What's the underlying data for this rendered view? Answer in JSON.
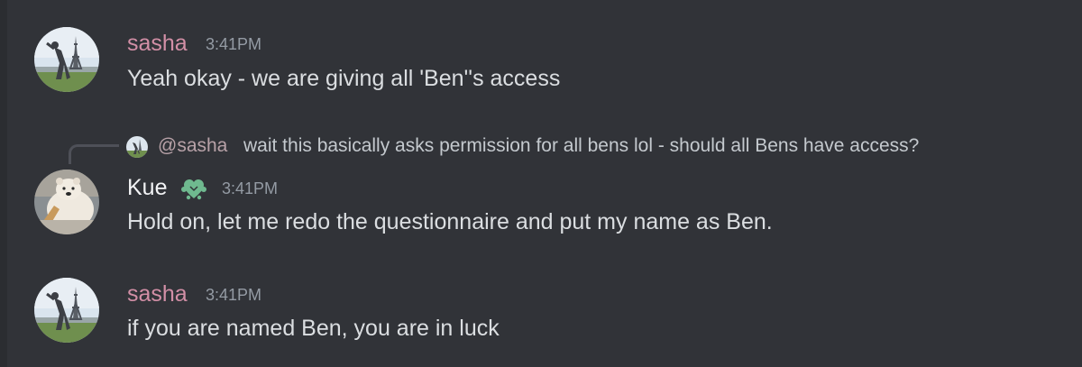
{
  "colors": {
    "background": "#313338",
    "sasha_name": "#d28fa6",
    "kue_name": "#f2f3f5",
    "timestamp": "#949ba4",
    "message_text": "#dbdee1",
    "reply_mention": "#b8a2a8",
    "badge_green": "#6fb98f"
  },
  "messages": [
    {
      "author": "sasha",
      "time": "3:41PM",
      "text": "Yeah okay - we are giving all 'Ben''s access",
      "avatar_icon": "eiffel-tower-avatar-icon"
    },
    {
      "reply": {
        "mention": "@sasha",
        "text": "wait this basically asks permission for all bens lol - should all Bens have access?",
        "avatar_icon": "eiffel-tower-avatar-icon"
      },
      "author": "Kue",
      "badge_icon": "heart-flower-badge-icon",
      "time": "3:41PM",
      "text": "Hold on, let me redo the questionnaire and put my name as Ben.",
      "avatar_icon": "polar-bear-avatar-icon"
    },
    {
      "author": "sasha",
      "time": "3:41PM",
      "text": "if you are named Ben, you are in luck",
      "avatar_icon": "eiffel-tower-avatar-icon"
    }
  ]
}
